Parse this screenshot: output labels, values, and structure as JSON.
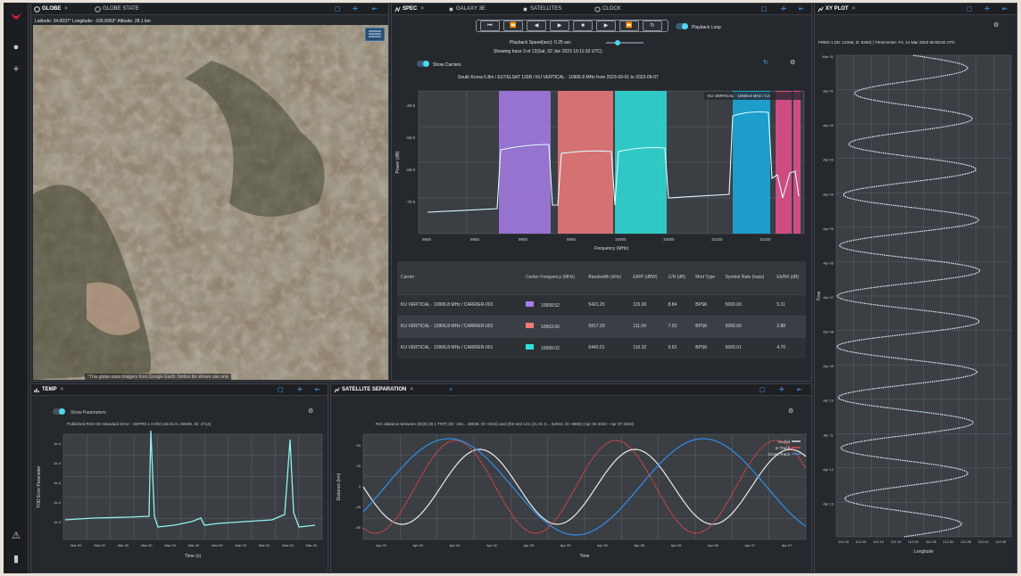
{
  "rail": {
    "logo": "brand-logo",
    "icons": [
      "user-icon",
      "plus-icon",
      "warning-icon",
      "info-icon"
    ]
  },
  "globe": {
    "tab_label": "GLOBE",
    "tab2_label": "GLOBE STATE",
    "status": "Latitude: 34.0037°  Longitude: -106.8953°  Altitude: 28.1 km",
    "attribution": "*This globe uses imagery from Google Earth. Notice for shown use only"
  },
  "spec": {
    "tabs": [
      "SPEC",
      "GALAXY 3E",
      "SATELLITES",
      "CLOCK"
    ],
    "playback_loop": "Playback Loop",
    "playback_speed": "Playback Speed(sec): 0.25 sec",
    "playback_info": "Showing trace 3 of 12(Sat, 02 Jan 2023 16:11:33 UTC)",
    "show_carriers": "Show Carriers",
    "chart_title": "South Korea 5.8m / EUTELSAT 133B / KU VERTICAL · 10906.8 MHz from 2023-09-01 to 2023-09-07",
    "chart_legend": "KU VERTICAL · 10906.8 MHz / CA",
    "table": {
      "headers": [
        "Carrier",
        "Center Frequency (MHz)",
        "Bandwidth (kHz)",
        "EIRP (dBW)",
        "C/N (dB)",
        "Mod Type",
        "Symbol Rate (ksps)",
        "Eb/N0 (dB)"
      ],
      "rows": [
        {
          "carrier": "KU VERTICAL · 10906.8 MHz / CARRIER-003",
          "color": "#a77de6",
          "freq": "10958.52",
          "bw": "5421.25",
          "eirp": "115.00",
          "cn": "8.84",
          "mod": "BPSK",
          "sr": "5000.00",
          "ebno": "5.11"
        },
        {
          "carrier": "KU VERTICAL · 10906.8 MHz / CARRIER-002",
          "color": "#f07a7a",
          "freq": "10963.00",
          "bw": "5817.29",
          "eirp": "111.04",
          "cn": "7.92",
          "mod": "BPSK",
          "sr": "5000.00",
          "ebno": "2.88"
        },
        {
          "carrier": "KU VERTICAL · 10906.8 MHz / CARRIER-001",
          "color": "#2fe0da",
          "freq": "10968.02",
          "bw": "5443.01",
          "eirp": "110.32",
          "cn": "9.62",
          "mod": "BPSK",
          "sr": "5000.01",
          "ebno": "4.70"
        }
      ]
    }
  },
  "xyplot": {
    "tab_label": "XY PLOT",
    "title": "FRED-1 (ID: 12345, D: 5250) | TimeCenter: Fri, 14 Mar 2023 00:00:00 UTC",
    "xlabel": "Longitude",
    "ylabel": "Time"
  },
  "temp": {
    "tab_label": "TEMP",
    "show_parameters": "Show Parameters",
    "title": "Published RS3 OD Standard Error - SEPR0 1 0 002 (48.01 N, 80005, ID: 4714)",
    "xlabel": "Time (s)",
    "ylabel": "TOD Error Parameter"
  },
  "sep": {
    "tab_label": "SATELLITE SEPARATION",
    "title": "RIC distance between (ID(0) 20,1 TRP) (ID: 163... 48036, ID: 0216) and (rb0 test 121 (21.91 S... 62915, ID: 6865) (Apr 03 2023 - Apr 07 2023)",
    "xlabel": "Time",
    "ylabel": "Distance (km)"
  },
  "chart_data": [
    {
      "type": "line",
      "panel": "spec",
      "title": "South Korea 5.8m / EUTELSAT 133B / KU VERTICAL · 10906.8 MHz from 2023-09-01 to 2023-09-07",
      "xlabel": "Frequency (MHz)",
      "ylabel": "Power (dB)",
      "xticks": [
        "9800",
        "9850",
        "9900",
        "9950",
        "10000",
        "10050",
        "10100",
        "10150"
      ],
      "yticks": [
        "-40.0",
        "-50.0",
        "-60.0",
        "-70.0"
      ],
      "carrier_bands": [
        {
          "color": "#a77de6"
        },
        {
          "color": "#f07a7a"
        },
        {
          "color": "#2fe0da"
        },
        {
          "color": "#19aee0"
        },
        {
          "color": "#e8508c"
        }
      ]
    },
    {
      "type": "line",
      "panel": "temp",
      "xticks": [
        "Mar 00",
        "Mar 00",
        "Mar 00",
        "Mar 00",
        "Mar 00",
        "Mar 00",
        "Mar 00",
        "Mar 00",
        "Mar 00",
        "Mar 00",
        "Mar 00"
      ],
      "yticks": [
        "1e-4",
        "1e-4",
        "1e-4",
        "1e-4",
        "1e-4"
      ],
      "xlabel": "Time (s)"
    },
    {
      "type": "line",
      "panel": "sep",
      "xlabel": "Time",
      "ylabel": "Distance (km)",
      "series": [
        {
          "name": "Radial",
          "color": "#e8ecef"
        },
        {
          "name": "In Track",
          "color": "#f04848"
        },
        {
          "name": "Cross Track",
          "color": "#2f8fe8"
        }
      ],
      "xticks": [
        "Apr 03",
        "Apr 03",
        "Apr 04",
        "Apr 04",
        "Apr 05",
        "Apr 05",
        "Apr 05",
        "Apr 06",
        "Apr 06",
        "Apr 06",
        "Apr 07",
        "Apr 07"
      ],
      "yticks": [
        "50",
        "25",
        "0",
        "-25",
        "-50"
      ]
    },
    {
      "type": "line",
      "panel": "xyplot",
      "xlabel": "Longitude",
      "ylabel": "Time",
      "xticks": [
        "112.00",
        "112.05",
        "112.10",
        "112.15",
        "112.20",
        "112.25",
        "112.30",
        "112.35",
        "112.40",
        "112.45"
      ],
      "yticks": [
        "Mar 31",
        "Apr 01",
        "Apr 02",
        "Apr 03",
        "Apr 04",
        "Apr 05",
        "Apr 06",
        "Apr 07",
        "Apr 08",
        "Apr 09",
        "Apr 10",
        "Apr 11",
        "Apr 12",
        "Apr 13"
      ]
    }
  ]
}
